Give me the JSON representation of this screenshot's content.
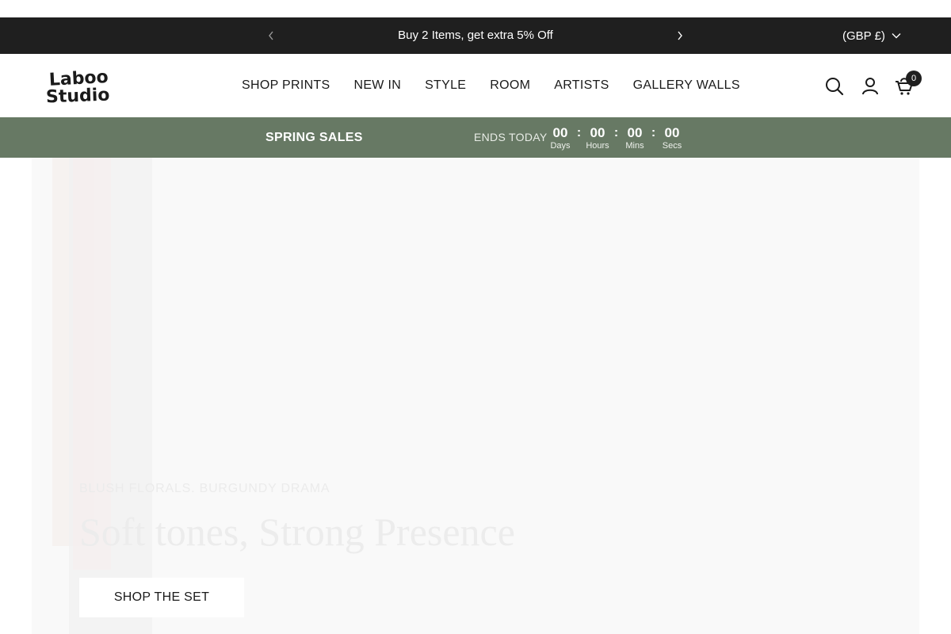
{
  "announcement": {
    "message": "Buy 2 Items, get extra 5% Off",
    "prev_icon": "chevron-left-icon",
    "next_icon": "chevron-right-icon",
    "currency": "(GBP £)"
  },
  "header": {
    "logo": {
      "line1": "Laboo",
      "line2": "Studio"
    },
    "nav": [
      {
        "label": "SHOP PRINTS"
      },
      {
        "label": "NEW IN"
      },
      {
        "label": "STYLE"
      },
      {
        "label": "ROOM"
      },
      {
        "label": "ARTISTS"
      },
      {
        "label": "GALLERY WALLS"
      }
    ],
    "cart_count": "0",
    "icons": [
      "search-icon",
      "account-icon",
      "cart-icon"
    ]
  },
  "sale_bar": {
    "title": "SPRING SALES",
    "ends": "ENDS TODAY",
    "countdown": [
      {
        "value": "00",
        "label": "Days"
      },
      {
        "value": "00",
        "label": "Hours"
      },
      {
        "value": "00",
        "label": "Mins"
      },
      {
        "value": "00",
        "label": "Secs"
      }
    ],
    "separator": ":",
    "background": "#677964"
  },
  "hero": {
    "eyebrow": "BLUSH FLORALS. BURGUNDY DRAMA",
    "headline": "Soft tones, Strong Presence",
    "cta_label": "SHOP THE SET"
  }
}
